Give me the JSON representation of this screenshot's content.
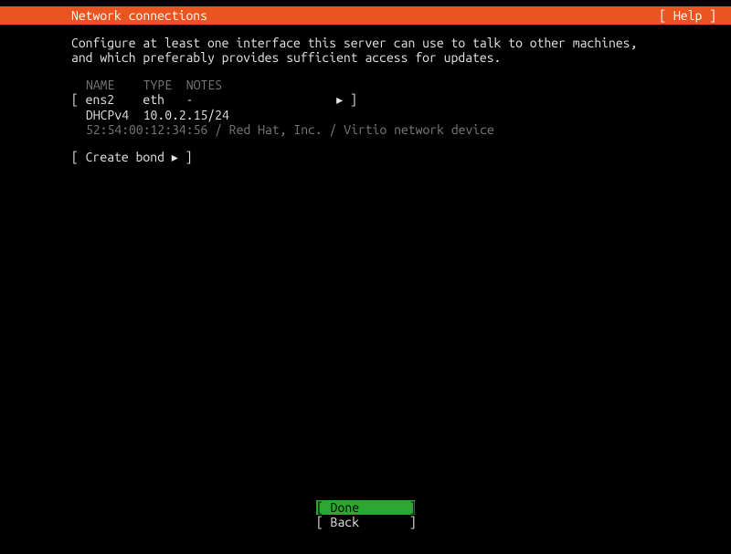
{
  "header": {
    "title": "Network connections",
    "help": "[ Help ]"
  },
  "description": "Configure at least one interface this server can use to talk to other machines, and which preferably provides sufficient access for updates.",
  "table": {
    "header": "NAME    TYPE  NOTES",
    "interface_row": "[ ens2    eth   -                    ▸ ]",
    "dhcp_row": "DHCPv4  10.0.2.15/24",
    "mac_row": "52:54:00:12:34:56 / Red Hat, Inc. / Virtio network device"
  },
  "create_bond": "[ Create bond ▸ ]",
  "footer": {
    "done": "[ Done       ]",
    "back": "[ Back       ]"
  }
}
